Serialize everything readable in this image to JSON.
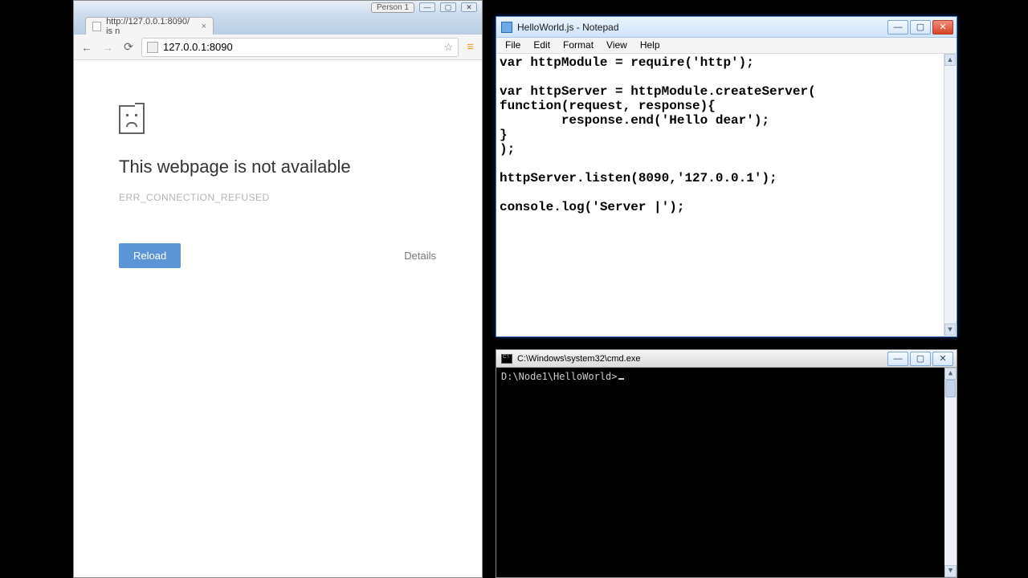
{
  "chrome": {
    "person_badge": "Person 1",
    "win_min": "—",
    "win_max": "▢",
    "win_close": "✕",
    "tab_title": "http://127.0.0.1:8090/ is n",
    "tab_close": "×",
    "back_icon": "←",
    "fwd_icon": "→",
    "reload_icon": "⟳",
    "url": "127.0.0.1:8090",
    "star_icon": "☆",
    "menu_icon": "≡",
    "error_heading": "This webpage is not available",
    "error_code": "ERR_CONNECTION_REFUSED",
    "reload_label": "Reload",
    "details_label": "Details"
  },
  "notepad": {
    "title": "HelloWorld.js - Notepad",
    "win_min": "—",
    "win_max": "▢",
    "win_close": "✕",
    "menu": {
      "file": "File",
      "edit": "Edit",
      "format": "Format",
      "view": "View",
      "help": "Help"
    },
    "code": "var httpModule = require('http');\n\nvar httpServer = httpModule.createServer(\nfunction(request, response){\n        response.end('Hello dear');\n}\n);\n\nhttpServer.listen(8090,'127.0.0.1');\n\nconsole.log('Server |');",
    "scroll_up": "▲",
    "scroll_down": "▼"
  },
  "cmd": {
    "title": "C:\\Windows\\system32\\cmd.exe",
    "win_min": "—",
    "win_max": "▢",
    "win_close": "✕",
    "prompt": "D:\\Node1\\HelloWorld>",
    "scroll_up": "▲",
    "scroll_down": "▼"
  }
}
